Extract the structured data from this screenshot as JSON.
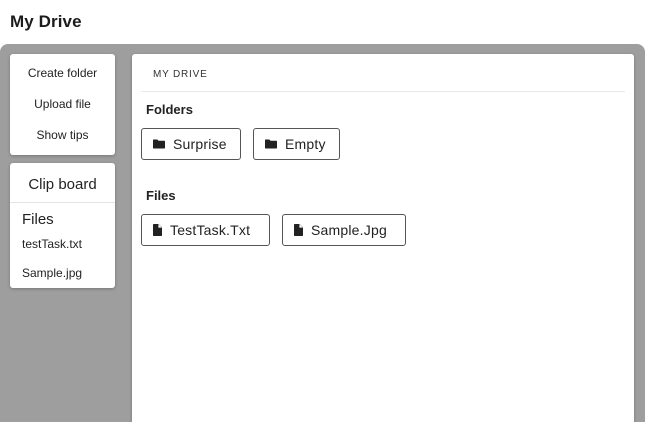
{
  "app": {
    "title": "My Drive"
  },
  "sidebar": {
    "actions": [
      {
        "label": "Create folder"
      },
      {
        "label": "Upload file"
      },
      {
        "label": "Show tips"
      }
    ],
    "clipboard": {
      "title": "Clip board",
      "files_heading": "Files",
      "files": [
        "testTask.txt",
        "Sample.jpg"
      ]
    }
  },
  "main": {
    "breadcrumb": "MY DRIVE",
    "folders_heading": "Folders",
    "folders": [
      {
        "name": "Surprise",
        "icon": "folder-icon"
      },
      {
        "name": "Empty",
        "icon": "folder-icon"
      }
    ],
    "files_heading": "Files",
    "files": [
      {
        "name": "TestTask.Txt",
        "icon": "file-icon"
      },
      {
        "name": "Sample.Jpg",
        "icon": "file-icon"
      }
    ]
  },
  "colors": {
    "workspace_bg": "#9e9e9e",
    "card_bg": "#ffffff",
    "text": "#222222",
    "button_border": "#555555"
  }
}
